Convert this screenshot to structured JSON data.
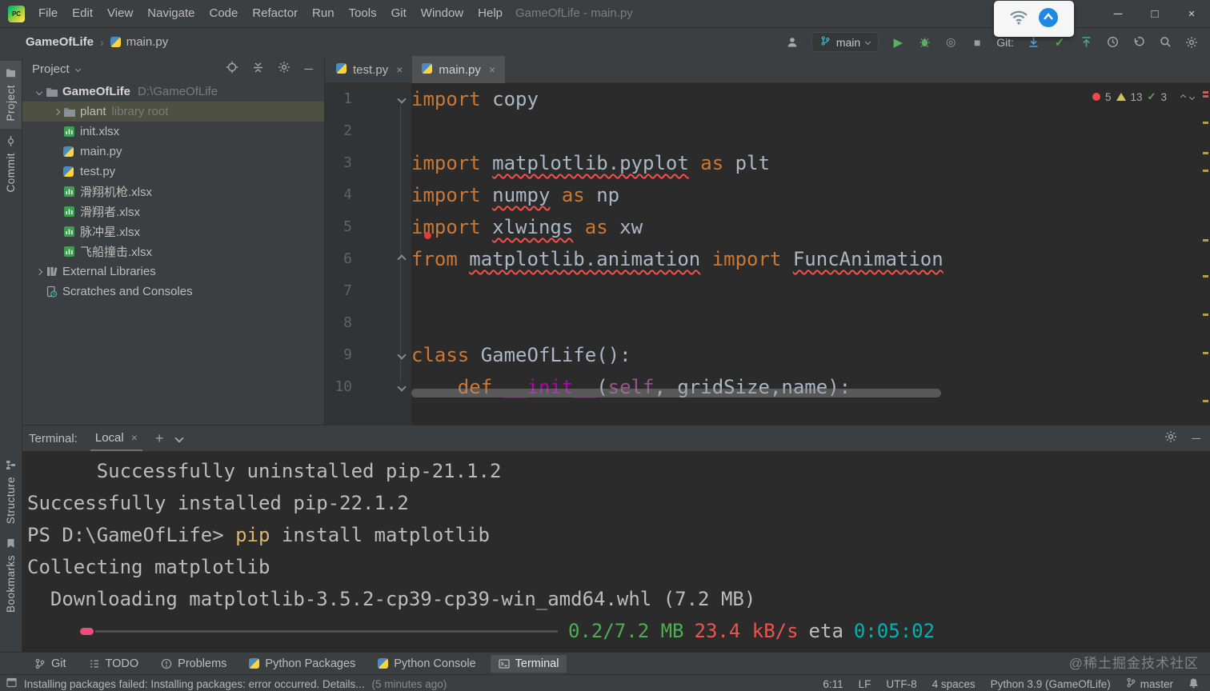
{
  "window": {
    "title": "GameOfLife - main.py",
    "menus": [
      "File",
      "Edit",
      "View",
      "Navigate",
      "Code",
      "Refactor",
      "Run",
      "Tools",
      "Git",
      "Window",
      "Help"
    ],
    "controls": [
      "minimize",
      "maximize",
      "close"
    ]
  },
  "navbar": {
    "breadcrumb": [
      "GameOfLife",
      "main.py"
    ],
    "branch": "main",
    "git_label": "Git:",
    "icons": [
      "user-icon",
      "git-branch-icon",
      "run-icon",
      "debug-icon",
      "coverage-icon",
      "stop-icon",
      "update-project-icon",
      "commit-check-icon",
      "push-icon",
      "history-icon",
      "undo-icon",
      "search-icon",
      "settings-icon"
    ]
  },
  "stripes": {
    "left_top": [
      {
        "label": "Project",
        "icon": "project",
        "active": true
      },
      {
        "label": "Commit",
        "icon": "commit"
      }
    ],
    "left_bottom": [
      {
        "label": "Structure",
        "icon": "structure"
      },
      {
        "label": "Bookmarks",
        "icon": "bookmark"
      }
    ]
  },
  "project_panel": {
    "title": "Project",
    "items": [
      {
        "label": "GameOfLife",
        "path": "D:\\GameOfLife",
        "icon": "folder",
        "chevron": "down",
        "bold": true,
        "indent": 0
      },
      {
        "label": "plant",
        "suffix": "library root",
        "icon": "folder",
        "chevron": "right",
        "selected": true,
        "indent": 1
      },
      {
        "label": "init.xlsx",
        "icon": "excel",
        "indent": 1
      },
      {
        "label": "main.py",
        "icon": "python",
        "indent": 1
      },
      {
        "label": "test.py",
        "icon": "python",
        "indent": 1
      },
      {
        "label": "滑翔机枪.xlsx",
        "icon": "excel",
        "indent": 1
      },
      {
        "label": "滑翔者.xlsx",
        "icon": "excel",
        "indent": 1
      },
      {
        "label": "脉冲星.xlsx",
        "icon": "excel",
        "indent": 1
      },
      {
        "label": "飞船撞击.xlsx",
        "icon": "excel",
        "indent": 1
      },
      {
        "label": "External Libraries",
        "icon": "library",
        "chevron": "right",
        "indent": 0
      },
      {
        "label": "Scratches and Consoles",
        "icon": "scratches",
        "indent": 0
      }
    ]
  },
  "editor": {
    "tabs": [
      {
        "label": "test.py",
        "active": false
      },
      {
        "label": "main.py",
        "active": true
      }
    ],
    "inspections": {
      "errors": "5",
      "warnings": "13",
      "passed": "3"
    },
    "lines": [
      {
        "n": "1",
        "fold": "down",
        "tokens": [
          [
            "kw",
            "import"
          ],
          [
            "pl",
            " copy"
          ]
        ]
      },
      {
        "n": "2",
        "tokens": []
      },
      {
        "n": "3",
        "tokens": [
          [
            "kw",
            "import"
          ],
          [
            "pl",
            " "
          ],
          [
            "err",
            "matplotlib.pyplot"
          ],
          [
            "pl",
            " "
          ],
          [
            "kw",
            "as"
          ],
          [
            "pl",
            " plt"
          ]
        ]
      },
      {
        "n": "4",
        "tokens": [
          [
            "kw",
            "import"
          ],
          [
            "pl",
            " "
          ],
          [
            "err",
            "numpy"
          ],
          [
            "pl",
            " "
          ],
          [
            "kw",
            "as"
          ],
          [
            "pl",
            " np"
          ]
        ]
      },
      {
        "n": "5",
        "tokens": [
          [
            "kw",
            "import"
          ],
          [
            "pl",
            " "
          ],
          [
            "err",
            "xlwings"
          ],
          [
            "pl",
            " "
          ],
          [
            "kw",
            "as"
          ],
          [
            "pl",
            " xw"
          ]
        ]
      },
      {
        "n": "6",
        "fold": "up",
        "tokens": [
          [
            "kw",
            "from"
          ],
          [
            "pl",
            " "
          ],
          [
            "err",
            "matplotlib.animation"
          ],
          [
            "pl",
            " "
          ],
          [
            "kw",
            "import"
          ],
          [
            "pl",
            " "
          ],
          [
            "err",
            "FuncAnimation"
          ]
        ]
      },
      {
        "n": "7",
        "tokens": []
      },
      {
        "n": "8",
        "tokens": []
      },
      {
        "n": "9",
        "fold": "down",
        "tokens": [
          [
            "kw",
            "class"
          ],
          [
            "pl",
            " GameOfLife():"
          ]
        ]
      },
      {
        "n": "10",
        "fold": "down",
        "tokens": [
          [
            "pl",
            "    "
          ],
          [
            "kw",
            "def"
          ],
          [
            "pl",
            " "
          ],
          [
            "magic",
            "__init__"
          ],
          [
            "pl",
            "("
          ],
          [
            "self",
            "self"
          ],
          [
            "pl",
            ", gridSize,name):"
          ]
        ]
      }
    ]
  },
  "terminal": {
    "label": "Terminal:",
    "tab": "Local",
    "lines": [
      [
        [
          "tdef",
          "      Successfully uninstalled pip-21.1.2"
        ]
      ],
      [
        [
          "tdef",
          "Successfully installed pip-22.1.2"
        ]
      ],
      [
        [
          "tdef",
          "PS D:\\GameOfLife> "
        ],
        [
          "tyellow",
          "pip"
        ],
        [
          "tdef",
          " install matplotlib"
        ]
      ],
      [
        [
          "tdef",
          "Collecting matplotlib"
        ]
      ],
      [
        [
          "tdef",
          "  Downloading matplotlib-3.5.2-cp39-cp39-win_amd64.whl (7.2 MB)"
        ]
      ]
    ],
    "progress": {
      "size": "0.2/7.2 MB",
      "speed": "23.4 kB/s",
      "eta_label": "eta",
      "eta": "0:05:02"
    }
  },
  "toolbar_bottom": {
    "items": [
      {
        "icon": "git-branch",
        "label": "Git"
      },
      {
        "icon": "todo",
        "label": "TODO"
      },
      {
        "icon": "problems",
        "label": "Problems"
      },
      {
        "icon": "python",
        "label": "Python Packages"
      },
      {
        "icon": "python",
        "label": "Python Console"
      },
      {
        "icon": "terminal",
        "label": "Terminal",
        "active": true
      }
    ]
  },
  "statusbar": {
    "message": "Installing packages failed: Installing packages: error occurred. Details...",
    "time": "(5 minutes ago)",
    "items": [
      "6:11",
      "LF",
      "UTF-8",
      "4 spaces",
      "Python 3.9 (GameOfLife)"
    ],
    "branch": "master"
  },
  "watermark": "@稀土掘金技术社区",
  "colors": {
    "panel_bg": "#3c3f41",
    "editor_bg": "#2b2b2b",
    "keyword_orange": "#cc7832",
    "text_default": "#a9b7c6",
    "error_red": "#f2504d",
    "warning_yellow": "#d6bf55",
    "run_green": "#5caf5f",
    "terminal_green": "#4fae52",
    "terminal_red": "#ef5350",
    "terminal_cyan": "#00b2b2",
    "terminal_yellow": "#dbb56d",
    "progress_pink": "#e8507a",
    "selection_olive": "#4e5041"
  }
}
